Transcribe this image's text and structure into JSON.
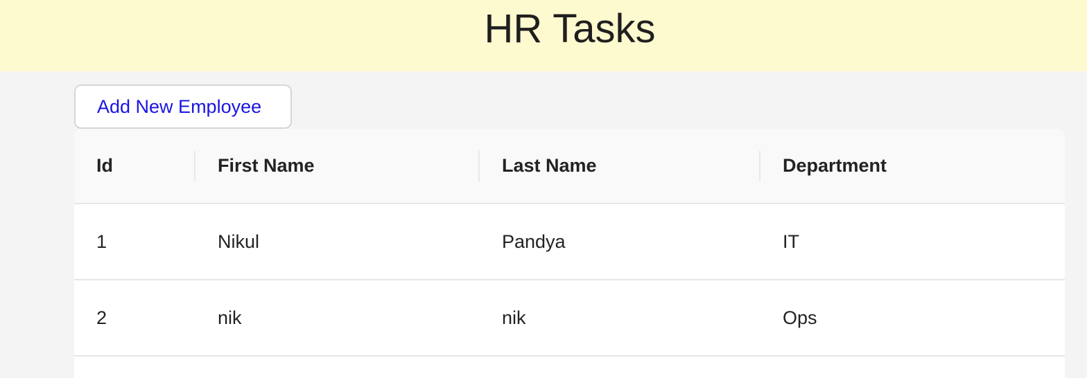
{
  "header": {
    "title": "HR Tasks"
  },
  "toolbar": {
    "add_button_label": "Add New Employee"
  },
  "table": {
    "columns": [
      "Id",
      "First Name",
      "Last Name",
      "Department"
    ],
    "rows": [
      {
        "id": "1",
        "first_name": "Nikul",
        "last_name": "Pandya",
        "department": "IT"
      },
      {
        "id": "2",
        "first_name": "nik",
        "last_name": "nik",
        "department": "Ops"
      }
    ]
  },
  "colors": {
    "header_bg": "#fefacf",
    "page_bg": "#f4f4f4",
    "link_blue": "#1a14e0"
  }
}
